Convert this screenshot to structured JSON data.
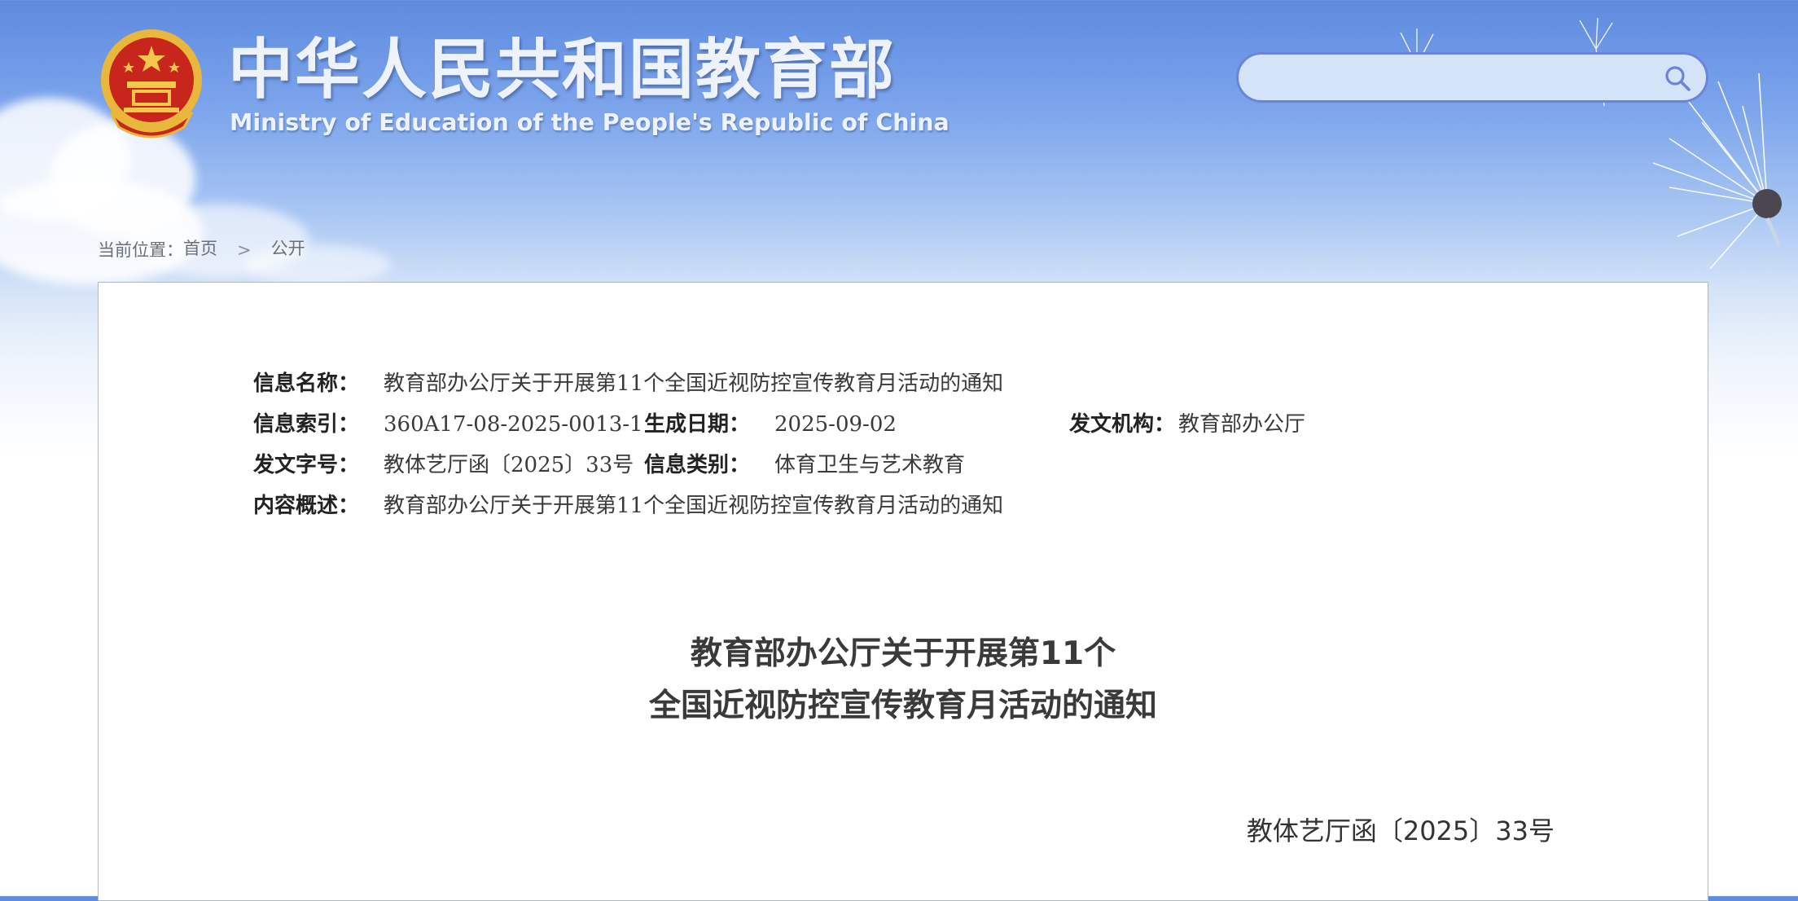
{
  "header": {
    "title_cn": "中华人民共和国教育部",
    "title_en": "Ministry of Education of the People's Republic of China",
    "emblem_icon": "national-emblem-icon",
    "colors": {
      "sky": "#6f98e6",
      "emblem_red": "#c8261c",
      "emblem_gold": "#e8b73c"
    }
  },
  "search": {
    "value": "",
    "icon": "search-icon",
    "border_color": "#6d83d9"
  },
  "breadcrumb": {
    "prefix": "当前位置：",
    "home": "首页",
    "separator": ">",
    "current": "公开"
  },
  "meta": {
    "name_label": "信息名称：",
    "name_value": "教育部办公厅关于开展第11个全国近视防控宣传教育月活动的通知",
    "index_label": "信息索引：",
    "index_value": "360A17-08-2025-0013-1",
    "date_label": "生成日期：",
    "date_value": "2025-09-02",
    "org_label": "发文机构：",
    "org_value": "教育部办公厅",
    "docno_label": "发文字号：",
    "docno_value": "教体艺厅函〔2025〕33号",
    "category_label": "信息类别：",
    "category_value": "体育卫生与艺术教育",
    "summary_label": "内容概述：",
    "summary_value": "教育部办公厅关于开展第11个全国近视防控宣传教育月活动的通知"
  },
  "document": {
    "title_line1": "教育部办公厅关于开展第11个",
    "title_line2": "全国近视防控宣传教育月活动的通知",
    "number": "教体艺厅函〔2025〕33号"
  }
}
